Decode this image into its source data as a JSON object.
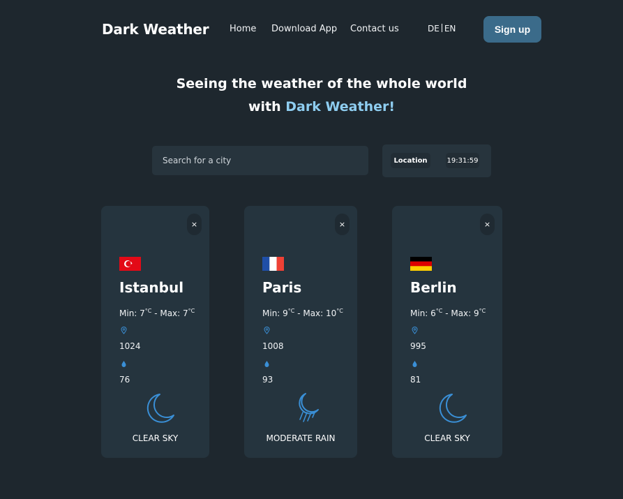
{
  "header": {
    "brand": "Dark Weather",
    "nav": [
      "Home",
      "Download App",
      "Contact us"
    ],
    "lang": {
      "de": "DE",
      "en": "EN"
    },
    "signup_label": "Sign up"
  },
  "hero": {
    "line1": "Seeing the weather of the whole world",
    "line2_prefix": "with ",
    "line2_accent": "Dark Weather!"
  },
  "search": {
    "placeholder": "Search for a city",
    "location_label": "Location",
    "time": "19:31:59"
  },
  "cards": [
    {
      "city": "Istanbul",
      "flag": "turkey-flag",
      "min": "7",
      "max": "7",
      "unit": "°C",
      "pressure": "1024",
      "humidity": "76",
      "icon": "moon-icon",
      "description": "CLEAR SKY",
      "close": "×"
    },
    {
      "city": "Paris",
      "flag": "france-flag",
      "min": "9",
      "max": "10",
      "unit": "°C",
      "pressure": "1008",
      "humidity": "93",
      "icon": "moon-rain-icon",
      "description": "MODERATE RAIN",
      "close": "×"
    },
    {
      "city": "Berlin",
      "flag": "germany-flag",
      "min": "6",
      "max": "9",
      "unit": "°C",
      "pressure": "995",
      "humidity": "81",
      "icon": "moon-icon",
      "description": "CLEAR SKY",
      "close": "×"
    }
  ],
  "colors": {
    "background": "#1e272e",
    "card": "#25343e",
    "accent": "#8ecdf0",
    "signup": "#3b6b8a",
    "icon_blue": "#3a8fd6"
  }
}
